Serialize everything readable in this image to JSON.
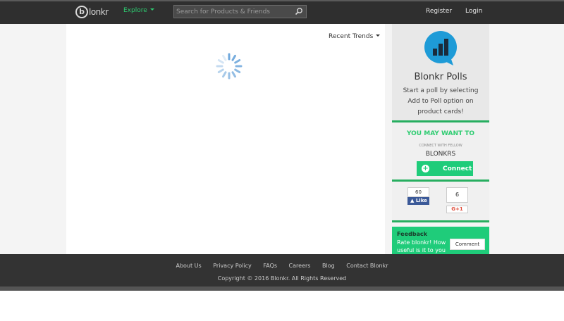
{
  "header": {
    "logo_letter": "b",
    "logo_text": "lonkr",
    "explore_label": "Explore",
    "search_placeholder": "Search for Products & Friends",
    "register_label": "Register",
    "login_label": "Login"
  },
  "main": {
    "trends_label": "Recent Trends"
  },
  "sidebar": {
    "polls_title": "Blonkr Polls",
    "polls_desc": "Start a poll by selecting Add to Poll option on product cards!",
    "maybe_title": "YOU MAY WANT TO",
    "maybe_sub": "CONNECT WITH FELLOW",
    "maybe_sub2": "BLONKRS",
    "connect_label": "Connect",
    "fb_count": "60",
    "fb_like_label": "Like",
    "gp_count": "6",
    "gp_label": "G+1",
    "feedback_title": "Feedback",
    "feedback_text": "Rate blonkr! How useful is it to you",
    "comment_label": "Comment"
  },
  "footer": {
    "links": [
      "About Us",
      "Privacy Policy",
      "FAQs",
      "Careers",
      "Blog",
      "Contact Blonkr"
    ],
    "copyright": "Copyright © 2016 Blonkr. All Rights Reserved"
  },
  "colors": {
    "accent": "#2ecc71",
    "topbar": "#2f2f2f",
    "footer": "#333333",
    "poll_icon": "#1e9bd7"
  },
  "icons": [
    "search-icon",
    "poll-chart-icon",
    "loading-spinner-icon",
    "plus-icon",
    "thumbs-up-icon"
  ]
}
